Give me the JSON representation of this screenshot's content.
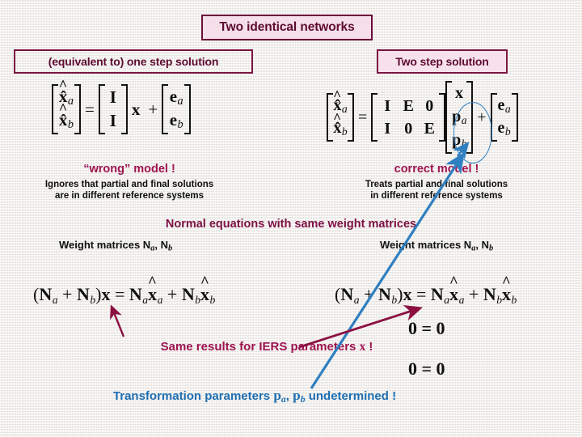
{
  "slide": {
    "background_color": "#eeece8",
    "title": "Two identical networks",
    "title_colors": {
      "text": "#5d0b31",
      "border": "#6a0f38",
      "fill": "#f5dfe9"
    }
  },
  "columns": {
    "left_header": "(equivalent to) one step solution",
    "right_header": "Two step solution"
  },
  "equations": {
    "left_top": {
      "lhs": {
        "rows": [
          "x̂",
          "x̂"
        ],
        "subs": [
          "a",
          "b"
        ]
      },
      "equals": "=",
      "design": {
        "rows": [
          [
            "I"
          ],
          [
            "I"
          ]
        ]
      },
      "unknown": "x",
      "plus": "+",
      "errors": {
        "rows": [
          "e",
          "e"
        ],
        "subs": [
          "a",
          "b"
        ]
      }
    },
    "right_top": {
      "lhs": {
        "rows": [
          "x̂",
          "x̂"
        ],
        "subs": [
          "a",
          "b"
        ]
      },
      "equals": "=",
      "design": {
        "rows": [
          [
            "I",
            "E",
            "0"
          ],
          [
            "I",
            "0",
            "E"
          ]
        ]
      },
      "unknowns": {
        "rows": [
          "x",
          "p",
          "p"
        ],
        "subs": [
          "",
          "a",
          "b"
        ]
      },
      "plus": "+",
      "errors": {
        "rows": [
          "e",
          "e"
        ],
        "subs": [
          "a",
          "b"
        ]
      }
    },
    "normal_left": "( N_a + N_b ) x = N_a x̂_a + N_b x̂_b",
    "normal_right": "( N_a + N_b ) x = N_a x̂_a + N_b x̂_b",
    "zero_1": "0 = 0",
    "zero_2": "0 = 0"
  },
  "callouts": {
    "wrong_heading": "“wrong” model !",
    "wrong_detail_line1": "Ignores that partial and final solutions",
    "wrong_detail_line2": "are in different reference systems",
    "correct_heading": "correct model !",
    "correct_detail_line1": "Treats partial and final solutions",
    "correct_detail_line2": "in different reference systems",
    "normal_equations_heading": "Normal equations with same weight matrices",
    "weight_matrices_left": "Weight matrices N",
    "weight_matrices_left_sub_a": "a",
    "weight_matrices_left_mid": ", N",
    "weight_matrices_left_sub_b": "b",
    "weight_matrices_right": "Weight matrices N",
    "weight_matrices_right_sub_a": "a",
    "weight_matrices_right_mid": ", N",
    "weight_matrices_right_sub_b": "b",
    "same_results_prefix": "Same results for IERS parameters ",
    "same_results_symbol": "x",
    "same_results_suffix": " !",
    "transformation_prefix": "Transformation parameters ",
    "transformation_symbol_a": "p",
    "transformation_symbol_a_sub": "a",
    "transformation_comma": ", ",
    "transformation_symbol_b": "p",
    "transformation_symbol_b_sub": "b",
    "transformation_suffix": " undetermined !"
  },
  "annotations": {
    "blue_color": "#2f7fc1",
    "maroon_color": "#8b1040",
    "ellipse_label": "p_a, p_b highlighted",
    "blue_arrow_label": "undetermined transformation parameters to correct model",
    "maroon_arrow_right_label": "same results to right normal equation",
    "maroon_arrow_left_label": "same results to left normal equation"
  }
}
